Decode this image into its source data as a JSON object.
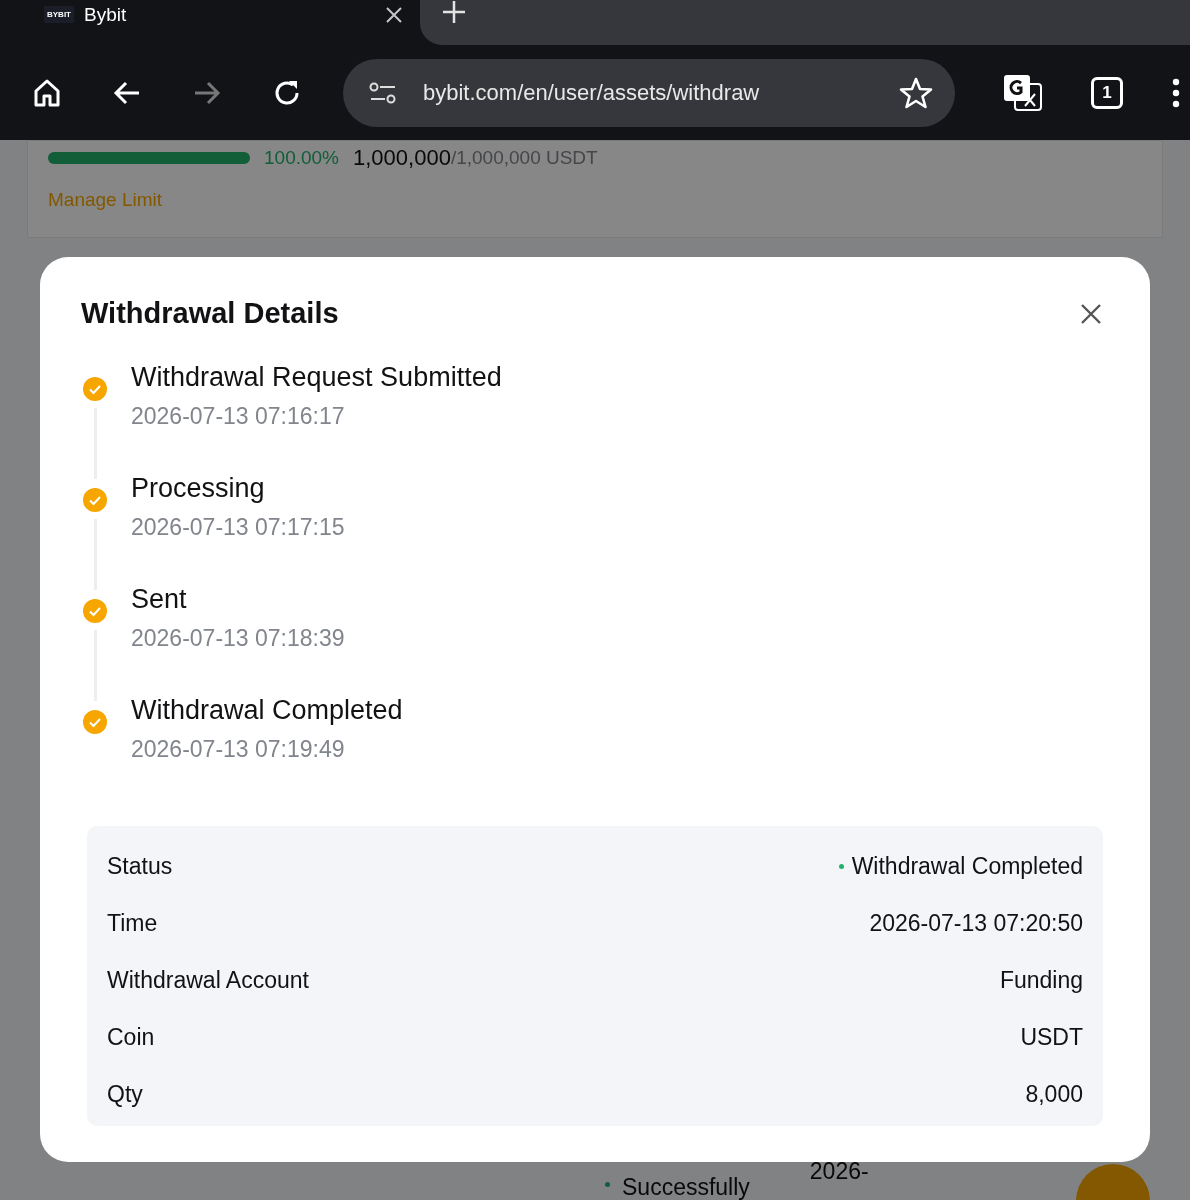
{
  "browser": {
    "tab": {
      "title": "Bybit",
      "favicon": "BYBIT"
    },
    "url": "bybit.com/en/user/assets/withdraw",
    "tab_count": "1"
  },
  "page": {
    "limit": {
      "level": 1.0,
      "percent": "100.00%",
      "used": "1,000,000",
      "total": "/1,000,000 USDT"
    },
    "manage_link": "Manage Limit",
    "row_status": "Successfully",
    "row_date": "2026-"
  },
  "modal": {
    "title": "Withdrawal Details",
    "steps": [
      {
        "label": "Withdrawal Request Submitted",
        "time": "2026-07-13 07:16:17",
        "completed": true
      },
      {
        "label": "Processing",
        "time": "2026-07-13 07:17:15",
        "completed": true
      },
      {
        "label": "Sent",
        "time": "2026-07-13 07:18:39",
        "completed": true
      },
      {
        "label": "Withdrawal Completed",
        "time": "2026-07-13 07:19:49",
        "completed": true
      }
    ],
    "details": [
      {
        "label": "Status",
        "value": "Withdrawal Completed",
        "kind": "status",
        "color": "#20b26c"
      },
      {
        "label": "Time",
        "value": "2026-07-13 07:20:50",
        "kind": "text"
      },
      {
        "label": "Withdrawal Account",
        "value": "Funding",
        "kind": "text"
      },
      {
        "label": "Coin",
        "value": "USDT",
        "kind": "text"
      },
      {
        "label": "Qty",
        "value": "8,000",
        "kind": "text"
      }
    ]
  }
}
